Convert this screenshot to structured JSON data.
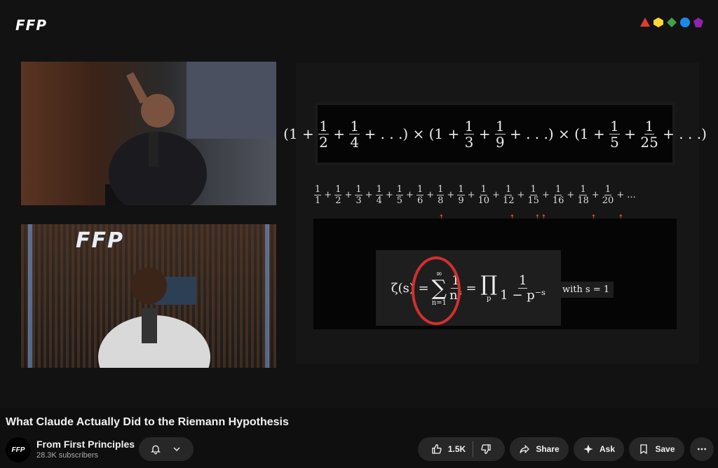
{
  "player": {
    "logo": "FFP",
    "overlay_logo": "FFP",
    "gem_colors": [
      "#e53935",
      "#fdd835",
      "#43a047",
      "#1e88e5",
      "#8e24aa"
    ],
    "top_equation": "(1 + 1/2 + 1/4 + ...) × (1 + 1/3 + 1/9 + ...) × (1 + 1/5 + 1/25 + ...)",
    "series_terms": [
      "1/1",
      "1/2",
      "1/3",
      "1/4",
      "1/5",
      "1/6",
      "1/8",
      "1/9",
      "1/10",
      "1/12",
      "1/15",
      "1/16",
      "1/18",
      "1/20"
    ],
    "series_tail": "...",
    "zeta_lhs": "ζ(s) =",
    "sum_upper": "∞",
    "sum_lower": "n=1",
    "sum_term_num": "1",
    "sum_term_den": "nˢ",
    "prod_lower": "p",
    "prod_term_num": "1",
    "prod_term_den": "1 − p⁻ˢ",
    "with_text": "with s = 1",
    "accent_color": "#d32f2f"
  },
  "video": {
    "title": "What Claude Actually Did to the Riemann Hypothesis"
  },
  "channel": {
    "avatar_text": "FFP",
    "name": "From First Principles",
    "subscribers": "28.3K subscribers"
  },
  "actions": {
    "like_count": "1.5K",
    "share_label": "Share",
    "ask_label": "Ask",
    "save_label": "Save"
  },
  "icons": {
    "bell": "bell-icon",
    "chevron": "chevron-down-icon",
    "like": "thumbs-up-icon",
    "dislike": "thumbs-down-icon",
    "share": "share-arrow-icon",
    "ask": "sparkle-icon",
    "save": "bookmark-icon",
    "more": "more-horizontal-icon"
  }
}
